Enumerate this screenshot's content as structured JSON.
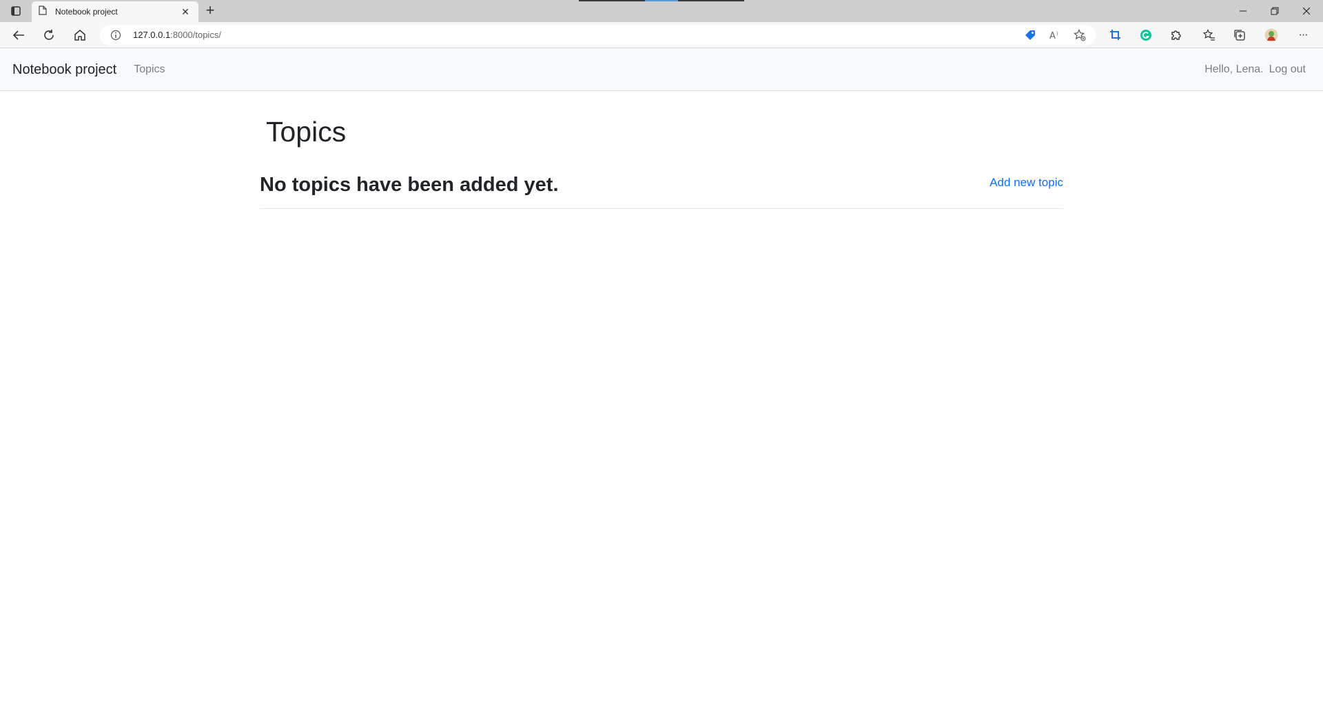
{
  "browser": {
    "tab_title": "Notebook project",
    "url_host": "127.0.0.1",
    "url_path": ":8000/topics/",
    "icons": {
      "tab_actions": "tab-actions-icon",
      "tab_favicon": "page-icon",
      "tab_close": "close-icon",
      "new_tab": "plus-icon",
      "back": "back-arrow-icon",
      "reload": "reload-icon",
      "home": "home-icon",
      "site_info": "info-icon",
      "shopping": "tag-icon",
      "read_aloud": "read-aloud-icon",
      "add_favorite": "star-plus-icon",
      "extension_blue": "crop-icon",
      "grammarly": "grammarly-icon",
      "extensions": "puzzle-icon",
      "favorites": "favorites-icon",
      "collections": "collections-icon",
      "profile": "profile-avatar",
      "menu": "more-icon",
      "minimize": "minimize-icon",
      "restore": "restore-icon",
      "close_window": "close-icon"
    },
    "tab_close_glyph": "✕",
    "new_tab_glyph": "+",
    "menu_glyph": "···"
  },
  "navbar": {
    "brand": "Notebook project",
    "topics_link": "Topics",
    "greeting": "Hello, Lena.",
    "logout": "Log out"
  },
  "main": {
    "title": "Topics",
    "add_link": "Add new topic",
    "empty_message": "No topics have been added yet."
  },
  "colors": {
    "link": "#0d6efd",
    "navbar_bg": "#f8f9fa",
    "text": "#212529",
    "muted": "#7a7f85"
  }
}
